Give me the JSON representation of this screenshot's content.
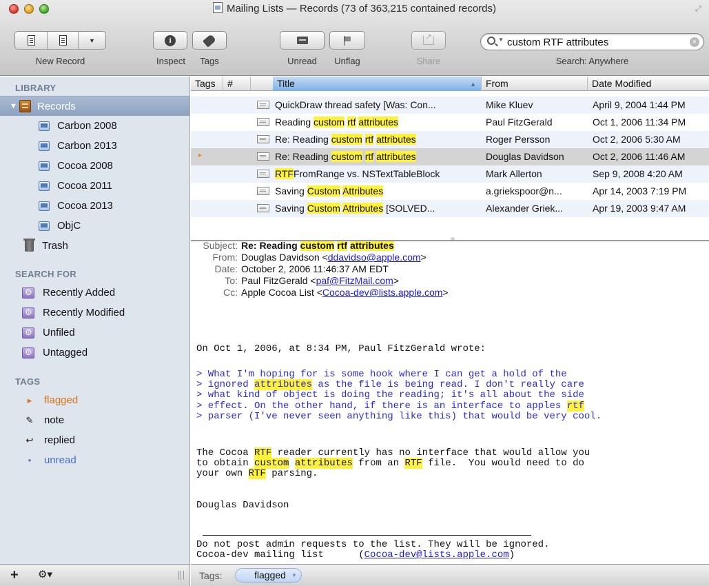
{
  "window": {
    "title": "Mailing Lists — Records (73 of 363,215 contained records)"
  },
  "toolbar": {
    "new_record": "New Record",
    "inspect": "Inspect",
    "tags": "Tags",
    "unread": "Unread",
    "unflag": "Unflag",
    "share": "Share",
    "search_value": "custom RTF attributes",
    "search_scope": "Search: Anywhere"
  },
  "sidebar": {
    "library_heading": "LIBRARY",
    "records_label": "Records",
    "groups": [
      {
        "label": "Carbon 2008"
      },
      {
        "label": "Carbon 2013"
      },
      {
        "label": "Cocoa 2008"
      },
      {
        "label": "Cocoa 2011"
      },
      {
        "label": "Cocoa 2013"
      },
      {
        "label": "ObjC"
      }
    ],
    "trash_label": "Trash",
    "search_heading": "SEARCH FOR",
    "searches": [
      {
        "label": "Recently Added"
      },
      {
        "label": "Recently Modified"
      },
      {
        "label": "Unfiled"
      },
      {
        "label": "Untagged"
      }
    ],
    "tags_heading": "TAGS",
    "tags": [
      {
        "label": "flagged",
        "icon": "▸",
        "color": "#d9731a"
      },
      {
        "label": "note",
        "icon": "✎",
        "color": "#111111"
      },
      {
        "label": "replied",
        "icon": "↩",
        "color": "#111111"
      },
      {
        "label": "unread",
        "icon": "•",
        "color": "#4a6fc9"
      }
    ]
  },
  "list": {
    "columns": {
      "tags": "Tags",
      "num": "#",
      "title": "Title",
      "from": "From",
      "date": "Date Modified"
    },
    "rows": [
      {
        "title": [
          {
            "t": "QuickDraw thread safety [Was: Con..."
          }
        ],
        "from": "Mike Kluev",
        "date": "April 9, 2004 1:44 PM"
      },
      {
        "title": [
          {
            "t": "Reading "
          },
          {
            "t": "custom",
            "hl": true
          },
          {
            "t": " "
          },
          {
            "t": "rtf",
            "hl": true
          },
          {
            "t": " "
          },
          {
            "t": "attributes",
            "hl": true
          }
        ],
        "from": "Paul FitzGerald",
        "date": "Oct 1, 2006 11:34 PM"
      },
      {
        "title": [
          {
            "t": "Re: Reading "
          },
          {
            "t": "custom",
            "hl": true
          },
          {
            "t": " "
          },
          {
            "t": "rtf",
            "hl": true
          },
          {
            "t": " "
          },
          {
            "t": "attributes",
            "hl": true
          }
        ],
        "from": "Roger Persson",
        "date": "Oct 2, 2006 5:30 AM"
      },
      {
        "title": [
          {
            "t": "Re: Reading "
          },
          {
            "t": "custom",
            "hl": true
          },
          {
            "t": " "
          },
          {
            "t": "rtf",
            "hl": true
          },
          {
            "t": " "
          },
          {
            "t": "attributes",
            "hl": true
          }
        ],
        "from": "Douglas Davidson",
        "date": "Oct 2, 2006 11:46 AM",
        "selected": true
      },
      {
        "title": [
          {
            "t": "RTF",
            "hl": true
          },
          {
            "t": "FromRange vs. NSTextTableBlock"
          }
        ],
        "from": "Mark Allerton",
        "date": "Sep 9, 2008 4:20 AM"
      },
      {
        "title": [
          {
            "t": "Saving "
          },
          {
            "t": "Custom",
            "hl": true
          },
          {
            "t": " "
          },
          {
            "t": "Attributes",
            "hl": true
          }
        ],
        "from": "a.griekspoor@n...",
        "date": "Apr 14, 2003 7:19 PM"
      },
      {
        "title": [
          {
            "t": "Saving "
          },
          {
            "t": "Custom",
            "hl": true
          },
          {
            "t": " "
          },
          {
            "t": "Attributes",
            "hl": true
          },
          {
            "t": " [SOLVED..."
          }
        ],
        "from": "Alexander Griek...",
        "date": "Apr 19, 2003 9:47 AM"
      }
    ]
  },
  "message": {
    "labels": {
      "subject": "Subject:",
      "from": "From:",
      "date": "Date:",
      "to": "To:",
      "cc": "Cc:"
    },
    "subject": [
      {
        "t": "Re: Reading "
      },
      {
        "t": "custom",
        "hl": true
      },
      {
        "t": " "
      },
      {
        "t": "rtf",
        "hl": true
      },
      {
        "t": " "
      },
      {
        "t": "attributes",
        "hl": true
      }
    ],
    "from_name": "Douglas Davidson <",
    "from_email": "ddavidso@apple.com",
    "date": "October 2, 2006 11:46:37 AM EDT",
    "to_name": "Paul FitzGerald <",
    "to_email": "paf@FitzMail.com",
    "cc_name": "Apple Cocoa List <",
    "cc_email": "Cocoa-dev@lists.apple.com",
    "intro": "On Oct 1, 2006, at 8:34 PM, Paul FitzGerald wrote:",
    "quote": [
      [
        {
          "t": "> What I'm hoping for is some hook where I can get a hold of the"
        }
      ],
      [
        {
          "t": "> ignored "
        },
        {
          "t": "attributes",
          "hl": true
        },
        {
          "t": " as the file is being read. I don't really care"
        }
      ],
      [
        {
          "t": "> what kind of object is doing the reading; it's all about the side"
        }
      ],
      [
        {
          "t": "> effect. On the other hand, if there is an interface to apples "
        },
        {
          "t": "rtf",
          "hl": true
        }
      ],
      [
        {
          "t": "> parser (I've never seen anything like this) that would be very cool."
        }
      ]
    ],
    "reply": [
      [
        {
          "t": "The Cocoa "
        },
        {
          "t": "RTF",
          "hl": true
        },
        {
          "t": " reader currently has no interface that would allow you"
        }
      ],
      [
        {
          "t": "to obtain "
        },
        {
          "t": "custom",
          "hl": true
        },
        {
          "t": " "
        },
        {
          "t": "attributes",
          "hl": true
        },
        {
          "t": " from an "
        },
        {
          "t": "RTF",
          "hl": true
        },
        {
          "t": " file.  You would need to do"
        }
      ],
      [
        {
          "t": "your own "
        },
        {
          "t": "RTF",
          "hl": true
        },
        {
          "t": " parsing."
        }
      ]
    ],
    "signature": "Douglas Davidson",
    "footer_line1": "Do not post admin requests to the list. They will be ignored.",
    "footer_line2": "Cocoa-dev mailing list      (",
    "footer_email": "Cocoa-dev@lists.apple.com",
    "footer_close": ")"
  },
  "tagbar": {
    "label": "Tags:",
    "token": "flagged"
  },
  "colors": {
    "highlight": "#fff23d",
    "selection": "#d4d4d4",
    "sidebar_selected": "#8ea3c0",
    "quote": "#2b2bd6",
    "link": "#1a1ade"
  }
}
